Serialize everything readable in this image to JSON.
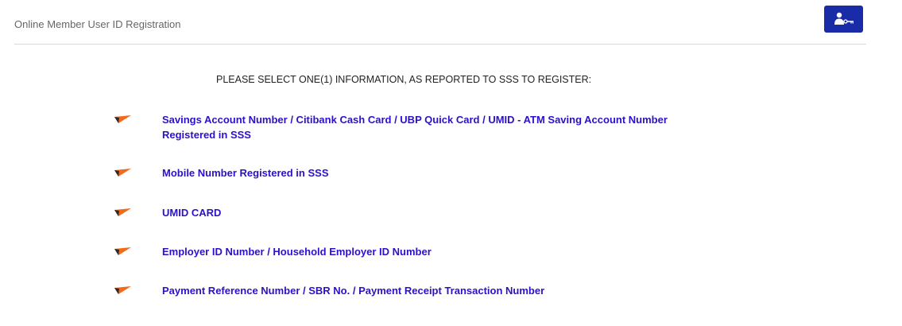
{
  "header": {
    "title": "Online Member User ID Registration",
    "user_button_icon": "user-key-icon"
  },
  "instruction": "PLEASE SELECT ONE(1) INFORMATION, AS REPORTED TO SSS TO REGISTER:",
  "options": [
    {
      "line1": "Savings Account Number / Citibank Cash Card / UBP Quick Card / UMID - ATM Saving Account Number",
      "line2": "Registered in SSS"
    },
    {
      "line1": "Mobile Number Registered in SSS"
    },
    {
      "line1": "UMID CARD"
    },
    {
      "line1": "Employer ID Number / Household Employer ID Number"
    },
    {
      "line1": "Payment Reference Number / SBR No. / Payment Receipt Transaction Number"
    }
  ],
  "colors": {
    "link": "#2b11c9",
    "button": "#1a2ba8",
    "arrow_orange": "#f26a1b",
    "arrow_dark": "#222222"
  }
}
